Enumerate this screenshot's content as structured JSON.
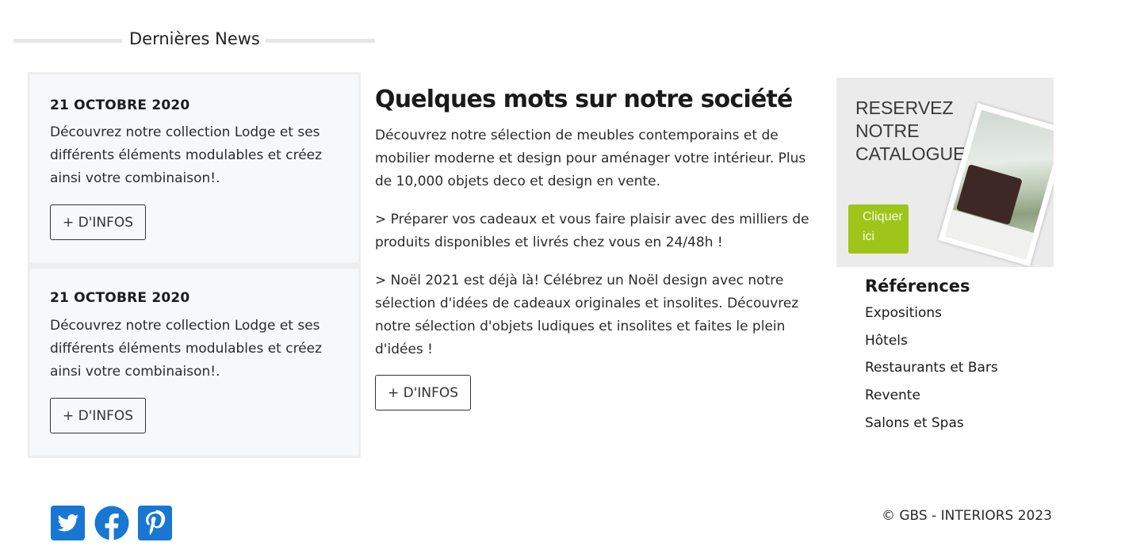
{
  "news": {
    "heading": "Dernières News",
    "items": [
      {
        "date": "21 OCTOBRE 2020",
        "text": "Découvrez notre collection Lodge et ses différents éléments modulables et créez ainsi votre combinaison!.",
        "button": "+ D'INFOS"
      },
      {
        "date": "21 OCTOBRE 2020",
        "text": "Découvrez notre collection Lodge et ses différents éléments modulables et créez ainsi votre combinaison!.",
        "button": "+ D'INFOS"
      }
    ]
  },
  "about": {
    "title": "Quelques mots sur notre société",
    "paragraphs": [
      "Découvrez notre sélection de meubles contemporains et de mobilier moderne et design pour aménager votre intérieur. Plus de 10,000 objets deco et design en vente.",
      "> Préparer vos cadeaux et vous faire plaisir avec des milliers de produits disponibles et livrés chez vous en 24/48h !",
      "> Noël 2021 est déjà là! Célébrez un Noël design avec notre sélection d'idées de cadeaux originales et insolites. Découvrez notre sélection d'objets ludiques et insolites et faites le plein d'idées !"
    ],
    "button": "+ D'INFOS"
  },
  "catalog": {
    "title": "RESERVEZ\nNOTRE\nCATALOGUE",
    "button": "Cliquer ici"
  },
  "references": {
    "title": "Références",
    "items": [
      "Expositions",
      "Hôtels",
      "Restaurants et Bars",
      "Revente",
      "Salons et Spas"
    ]
  },
  "footer": {
    "social": [
      "twitter-icon",
      "facebook-icon",
      "pinterest-icon"
    ],
    "copyright": "© GBS - INTERIORS 2023"
  },
  "colors": {
    "social_blue": "#1877d3",
    "catalog_button": "#9fc51a",
    "card_background": "#f7f8fa"
  }
}
